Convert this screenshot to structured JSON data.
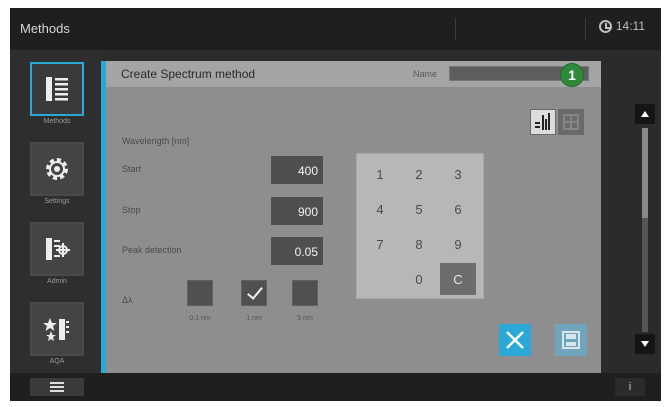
{
  "topbar": {
    "title": "Methods",
    "time": "14:11"
  },
  "sidebar": {
    "items": [
      {
        "label": "Methods",
        "icon": "methods-list-icon",
        "active": true
      },
      {
        "label": "Settings",
        "icon": "gear-icon",
        "active": false
      },
      {
        "label": "Admin",
        "icon": "admin-icon",
        "active": false
      },
      {
        "label": "AQA",
        "icon": "stars-icon",
        "active": false
      }
    ]
  },
  "dialog": {
    "title": "Create Spectrum method",
    "name_label": "Name",
    "name_value": "",
    "callout": "1",
    "wavelength_label": "Wavelength [nm]",
    "start": {
      "label": "Start",
      "value": "400"
    },
    "stop": {
      "label": "Stop",
      "value": "900"
    },
    "peak": {
      "label": "Peak detection",
      "value": "0.05"
    },
    "dl": {
      "label": "Δλ",
      "options": [
        {
          "label": "0.1 nm",
          "checked": false
        },
        {
          "label": "1 nm",
          "checked": true
        },
        {
          "label": "5 nm",
          "checked": false
        }
      ]
    },
    "keypad": [
      "1",
      "2",
      "3",
      "4",
      "5",
      "6",
      "7",
      "8",
      "9",
      "",
      "0",
      "C"
    ]
  },
  "colors": {
    "accent": "#2aa8d8",
    "callout": "#2e8a3a"
  }
}
